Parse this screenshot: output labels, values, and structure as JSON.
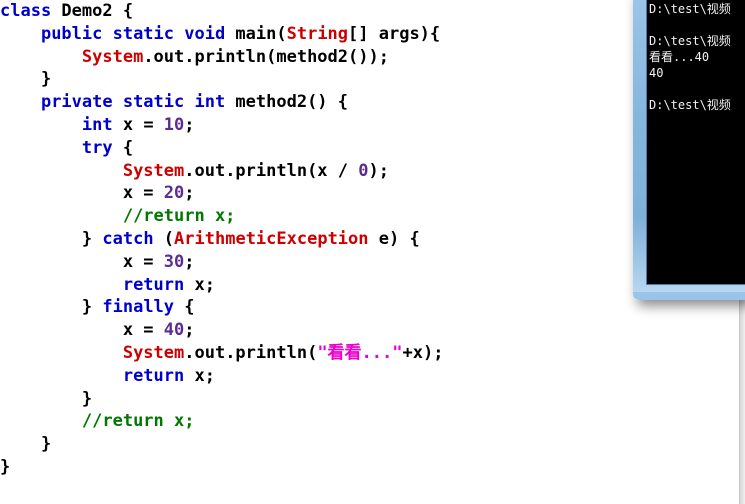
{
  "editor": {
    "language": "java",
    "colors": {
      "keyword": "#0000cc",
      "class_name": "#cc0000",
      "number": "#5c2d91",
      "string": "#ee00cc",
      "comment": "#007700",
      "plain": "#000000",
      "background": "#ffffff"
    },
    "lines": [
      {
        "indent": 0,
        "tokens": [
          {
            "t": "class ",
            "c": "kw"
          },
          {
            "t": "Demo2 {",
            "c": "pln"
          }
        ]
      },
      {
        "indent": 1,
        "tokens": [
          {
            "t": "public static void ",
            "c": "kw"
          },
          {
            "t": "main(",
            "c": "pln"
          },
          {
            "t": "String",
            "c": "cls"
          },
          {
            "t": "[] args){",
            "c": "pln"
          }
        ]
      },
      {
        "indent": 2,
        "tokens": [
          {
            "t": "System",
            "c": "cls"
          },
          {
            "t": ".out.println(method2());",
            "c": "pln"
          }
        ]
      },
      {
        "indent": 1,
        "tokens": [
          {
            "t": "}",
            "c": "pln"
          }
        ]
      },
      {
        "indent": 1,
        "tokens": [
          {
            "t": "private static int ",
            "c": "kw"
          },
          {
            "t": "method2() {",
            "c": "pln"
          }
        ]
      },
      {
        "indent": 2,
        "tokens": [
          {
            "t": "int ",
            "c": "kw"
          },
          {
            "t": "x = ",
            "c": "pln"
          },
          {
            "t": "10",
            "c": "num"
          },
          {
            "t": ";",
            "c": "pln"
          }
        ]
      },
      {
        "indent": 2,
        "tokens": [
          {
            "t": "try ",
            "c": "kw"
          },
          {
            "t": "{",
            "c": "pln"
          }
        ]
      },
      {
        "indent": 3,
        "tokens": [
          {
            "t": "System",
            "c": "cls"
          },
          {
            "t": ".out.println(x / ",
            "c": "pln"
          },
          {
            "t": "0",
            "c": "num"
          },
          {
            "t": ");",
            "c": "pln"
          }
        ]
      },
      {
        "indent": 3,
        "tokens": [
          {
            "t": "x = ",
            "c": "pln"
          },
          {
            "t": "20",
            "c": "num"
          },
          {
            "t": ";",
            "c": "pln"
          }
        ]
      },
      {
        "indent": 3,
        "tokens": [
          {
            "t": "//return x;",
            "c": "cmt"
          }
        ]
      },
      {
        "indent": 2,
        "tokens": [
          {
            "t": "} ",
            "c": "pln"
          },
          {
            "t": "catch ",
            "c": "kw"
          },
          {
            "t": "(",
            "c": "pln"
          },
          {
            "t": "ArithmeticException",
            "c": "cls"
          },
          {
            "t": " e) {",
            "c": "pln"
          }
        ]
      },
      {
        "indent": 3,
        "tokens": [
          {
            "t": "x = ",
            "c": "pln"
          },
          {
            "t": "30",
            "c": "num"
          },
          {
            "t": ";",
            "c": "pln"
          }
        ]
      },
      {
        "indent": 3,
        "tokens": [
          {
            "t": "return ",
            "c": "kw"
          },
          {
            "t": "x;",
            "c": "pln"
          }
        ]
      },
      {
        "indent": 2,
        "tokens": [
          {
            "t": "} ",
            "c": "pln"
          },
          {
            "t": "finally ",
            "c": "kw"
          },
          {
            "t": "{",
            "c": "pln"
          }
        ]
      },
      {
        "indent": 3,
        "tokens": [
          {
            "t": "x = ",
            "c": "pln"
          },
          {
            "t": "40",
            "c": "num"
          },
          {
            "t": ";",
            "c": "pln"
          }
        ]
      },
      {
        "indent": 3,
        "tokens": [
          {
            "t": "System",
            "c": "cls"
          },
          {
            "t": ".out.println(",
            "c": "pln"
          },
          {
            "t": "\"看看...\"",
            "c": "str"
          },
          {
            "t": "+x);",
            "c": "pln"
          }
        ]
      },
      {
        "indent": 3,
        "tokens": [
          {
            "t": "return ",
            "c": "kw"
          },
          {
            "t": "x;",
            "c": "pln"
          }
        ]
      },
      {
        "indent": 2,
        "tokens": [
          {
            "t": "}",
            "c": "pln"
          }
        ]
      },
      {
        "indent": 2,
        "tokens": [
          {
            "t": "//return x;",
            "c": "cmt"
          }
        ]
      },
      {
        "indent": 1,
        "tokens": [
          {
            "t": "}",
            "c": "pln"
          }
        ]
      },
      {
        "indent": 0,
        "tokens": [
          {
            "t": "}",
            "c": "pln"
          }
        ]
      }
    ]
  },
  "console": {
    "background": "#000000",
    "text_color": "#f2f2f2",
    "border_color": "#86b6de",
    "lines": [
      "D:\\test\\视频",
      "",
      "D:\\test\\视频",
      "看看...40",
      "40",
      "",
      "D:\\test\\视频"
    ]
  }
}
